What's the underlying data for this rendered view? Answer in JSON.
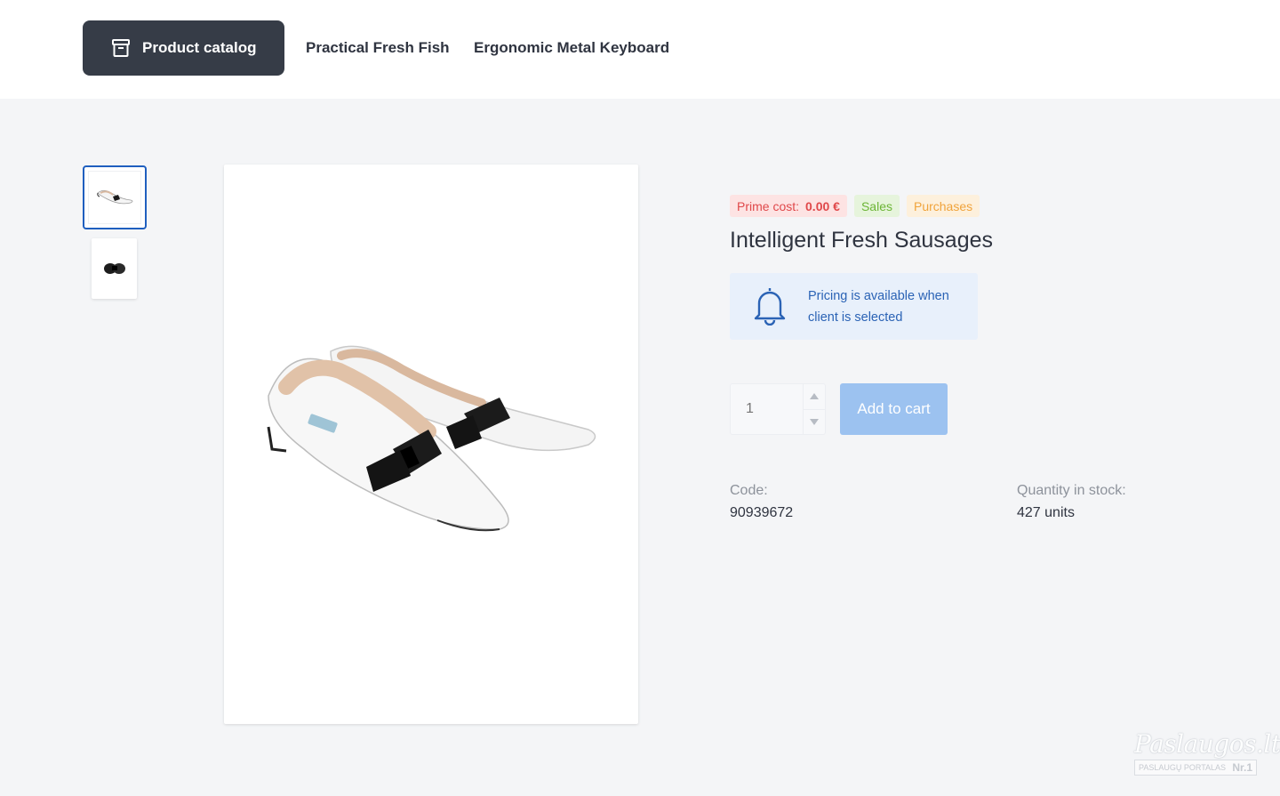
{
  "header": {
    "catalog_button": "Product catalog",
    "nav_links": [
      "Practical Fresh Fish",
      "Ergonomic Metal Keyboard"
    ]
  },
  "product": {
    "badges": {
      "prime_cost_label": "Prime cost:",
      "prime_cost_value": "0.00 €",
      "sales": "Sales",
      "purchases": "Purchases"
    },
    "title": "Intelligent Fresh Sausages",
    "pricing_notice": "Pricing is available when client is selected",
    "quantity_placeholder": "1",
    "add_to_cart": "Add to cart",
    "code_label": "Code:",
    "code_value": "90939672",
    "stock_label": "Quantity in stock:",
    "stock_value": "427 units"
  },
  "watermark": {
    "brand": "Paslaugos.lt",
    "tagline": "PASLAUGŲ PORTALAS",
    "rank": "Nr.1"
  },
  "colors": {
    "header_button": "#363c47",
    "selected_thumb_border": "#1f5fbf",
    "notice_bg": "#e8f0fb",
    "notice_text": "#2b63b5",
    "add_to_cart_bg": "#9cc2f0",
    "badge_cost": "#e0484a",
    "badge_sales": "#6cb536",
    "badge_purchases": "#f0a33b"
  },
  "icons": [
    "archive-icon",
    "bell-icon",
    "chevron-up-icon",
    "chevron-down-icon"
  ]
}
